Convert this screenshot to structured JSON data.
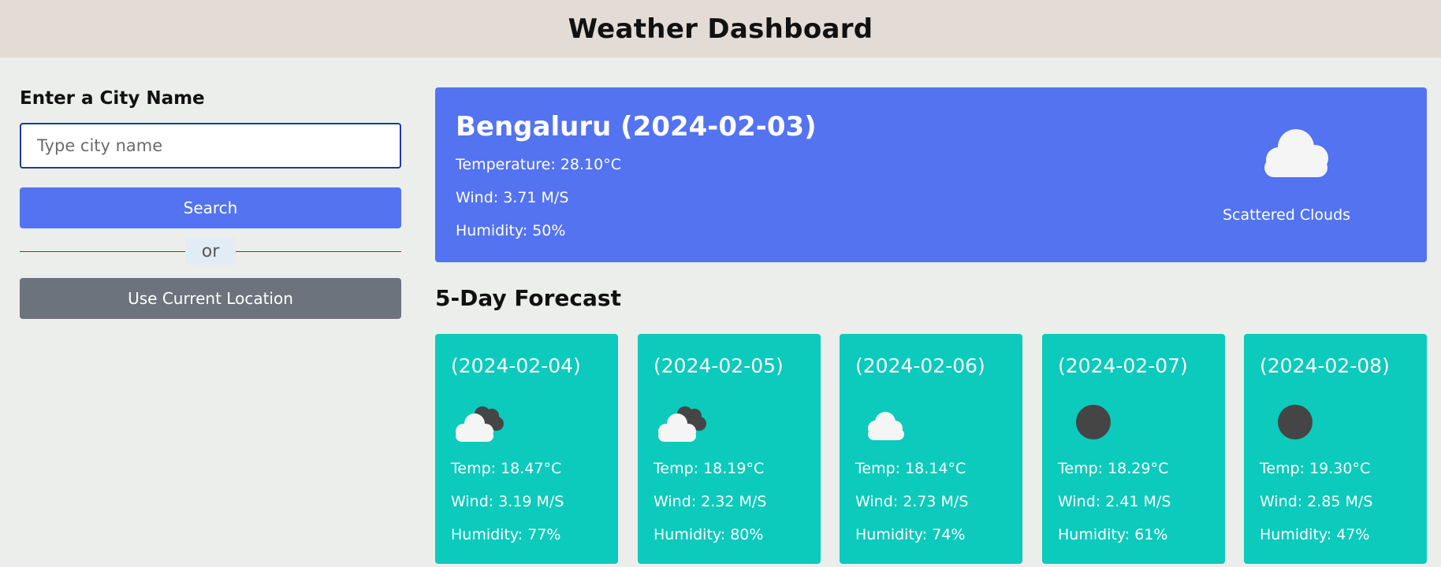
{
  "header": {
    "title": "Weather Dashboard"
  },
  "sidebar": {
    "label": "Enter a City Name",
    "city_input": {
      "placeholder": "Type city name",
      "value": ""
    },
    "search_label": "Search",
    "or_label": "or",
    "location_label": "Use Current Location"
  },
  "current": {
    "title": "Bengaluru (2024-02-03)",
    "temperature": "Temperature: 28.10°C",
    "wind": "Wind: 3.71 M/S",
    "humidity": "Humidity: 50%",
    "condition": "Scattered Clouds",
    "icon": "cloud-icon"
  },
  "forecast": {
    "title": "5-Day Forecast",
    "days": [
      {
        "date": "(2024-02-04)",
        "icon": "broken-clouds-icon",
        "temp": "Temp: 18.47°C",
        "wind": "Wind: 3.19 M/S",
        "humidity": "Humidity: 77%"
      },
      {
        "date": "(2024-02-05)",
        "icon": "broken-clouds-icon",
        "temp": "Temp: 18.19°C",
        "wind": "Wind: 2.32 M/S",
        "humidity": "Humidity: 80%"
      },
      {
        "date": "(2024-02-06)",
        "icon": "cloud-icon",
        "temp": "Temp: 18.14°C",
        "wind": "Wind: 2.73 M/S",
        "humidity": "Humidity: 74%"
      },
      {
        "date": "(2024-02-07)",
        "icon": "dark-circle-icon",
        "temp": "Temp: 18.29°C",
        "wind": "Wind: 2.41 M/S",
        "humidity": "Humidity: 61%"
      },
      {
        "date": "(2024-02-08)",
        "icon": "dark-circle-icon",
        "temp": "Temp: 19.30°C",
        "wind": "Wind: 2.85 M/S",
        "humidity": "Humidity: 47%"
      }
    ]
  },
  "colors": {
    "header_bg": "#e3dcd6",
    "page_bg": "#eceeec",
    "accent_blue": "#5373f0",
    "secondary_gray": "#6c737c",
    "card_teal": "#0ccabc"
  }
}
